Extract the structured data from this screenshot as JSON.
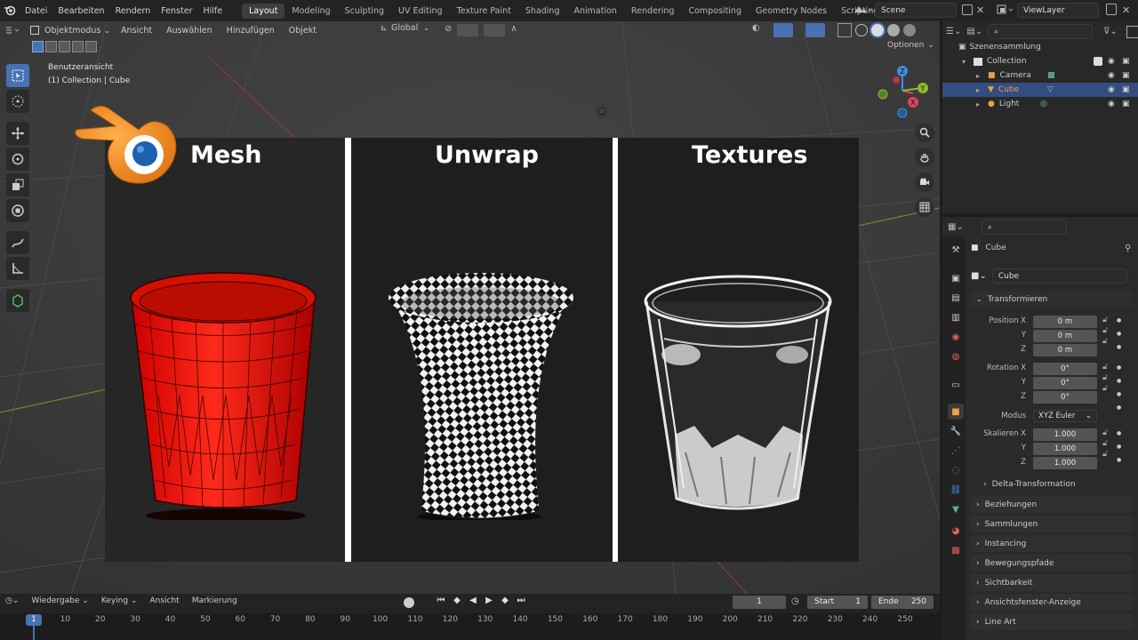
{
  "menu": [
    "Datei",
    "Bearbeiten",
    "Rendern",
    "Fenster",
    "Hilfe"
  ],
  "workspaces": [
    "Layout",
    "Modeling",
    "Sculpting",
    "UV Editing",
    "Texture Paint",
    "Shading",
    "Animation",
    "Rendering",
    "Compositing",
    "Geometry Nodes",
    "Scripting"
  ],
  "scene": "Scene",
  "view_layer": "ViewLayer",
  "viewport": {
    "mode": "Objektmodus",
    "menus": [
      "Ansicht",
      "Auswählen",
      "Hinzufügen",
      "Objekt"
    ],
    "orientation": "Global",
    "options": "Optionen",
    "view_name": "Benutzeransicht",
    "view_object": "(1) Collection | Cube",
    "overlay": {
      "labels": [
        "Mesh",
        "Unwrap",
        "Textures"
      ]
    }
  },
  "outliner": {
    "root": "Szenensammlung",
    "collection": "Collection",
    "items": [
      {
        "label": "Camera"
      },
      {
        "label": "Cube"
      },
      {
        "label": "Light"
      }
    ]
  },
  "properties": {
    "object_name": "Cube",
    "data_name": "Cube",
    "transform": {
      "title": "Transformieren",
      "position_label": "Position X",
      "pos_x": "0 m",
      "pos_y": "0 m",
      "pos_z": "0 m",
      "rotation_label": "Rotation X",
      "rot_x": "0°",
      "rot_y": "0°",
      "rot_z": "0°",
      "mode_label": "Modus",
      "mode": "XYZ Euler",
      "scale_label": "Skalieren X",
      "scale_x": "1.000",
      "scale_y": "1.000",
      "scale_z": "1.000",
      "y": "Y",
      "z": "Z",
      "delta": "Delta-Transformation"
    },
    "panels": [
      "Beziehungen",
      "Sammlungen",
      "Instancing",
      "Bewegungspfade",
      "Sichtbarkeit",
      "Ansichtsfenster-Anzeige",
      "Line Art"
    ]
  },
  "timeline": {
    "menus": [
      "Wiedergabe",
      "Keying",
      "Ansicht",
      "Markierung"
    ],
    "current_frame": "1",
    "start_label": "Start",
    "start": "1",
    "end_label": "Ende",
    "end": "250",
    "ticks": [
      "1",
      "10",
      "20",
      "30",
      "40",
      "50",
      "60",
      "70",
      "80",
      "90",
      "100",
      "110",
      "120",
      "130",
      "140",
      "150",
      "160",
      "170",
      "180",
      "190",
      "200",
      "210",
      "220",
      "230",
      "240",
      "250"
    ]
  },
  "colors": {
    "accent": "#4772b3",
    "mesh_red": "#e01010",
    "logo_orange": "#f08a1c",
    "logo_blue": "#1e5fae"
  }
}
